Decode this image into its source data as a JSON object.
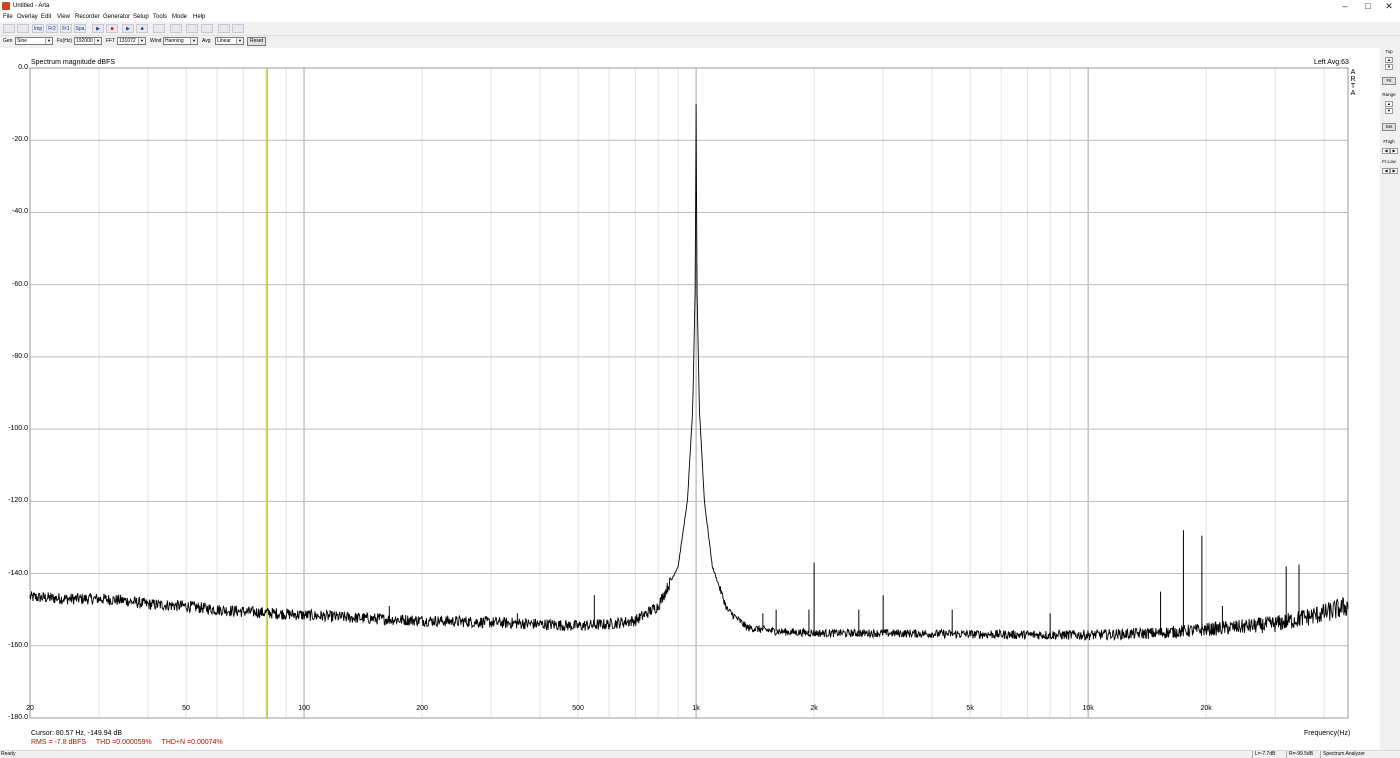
{
  "window": {
    "title": "Untitled - Arta",
    "minimize_glyph": "–",
    "maximize_glyph": "□",
    "close_glyph": "✕"
  },
  "menu": [
    "File",
    "Overlay",
    "Edit",
    "View",
    "Recorder",
    "Generator",
    "Setup",
    "Tools",
    "Mode",
    "Help"
  ],
  "toolbar_buttons": [
    {
      "icon": "open-icon",
      "glyph": ""
    },
    {
      "icon": "save-icon",
      "glyph": ""
    },
    {
      "icon": "impulse-response-icon",
      "glyph": "Imp"
    },
    {
      "icon": "frequency-response-2-icon",
      "glyph": "Fr2"
    },
    {
      "icon": "frequency-response-1-icon",
      "glyph": "Fr1"
    },
    {
      "icon": "spectrum-analyzer-icon",
      "glyph": "Spa"
    },
    {
      "icon": "play-icon",
      "glyph": "▶"
    },
    {
      "icon": "record-icon",
      "glyph": "■"
    },
    {
      "icon": "play-icon",
      "glyph": "▶"
    },
    {
      "icon": "stop-icon",
      "glyph": "■"
    },
    {
      "icon": "graph-icon",
      "glyph": ""
    },
    {
      "icon": "graph-options-icon",
      "glyph": ""
    },
    {
      "icon": "link-icon",
      "glyph": ""
    },
    {
      "icon": "toggle-icon",
      "glyph": ""
    },
    {
      "icon": "scope-icon",
      "glyph": ""
    },
    {
      "icon": "view-icon",
      "glyph": ""
    }
  ],
  "controls": {
    "gen_label": "Gen",
    "gen_value": "Sine",
    "fs_label": "Fs(Hz)",
    "fs_value": "192000",
    "fft_label": "FFT",
    "fft_value": "131072",
    "wind_label": "Wind",
    "wind_value": "Hanning",
    "avg_label": "Avg",
    "avg_value": "Linear",
    "reset_label": "Reset",
    "dropdown_arrow": "▼"
  },
  "chart_header": {
    "title": "Spectrum magnitude dBFS",
    "status": "Left  Avg:63",
    "logo_letters": [
      "A",
      "R",
      "T",
      "A"
    ]
  },
  "readouts": {
    "cursor": "Cursor: 80.57 Hz, -149.94 dB",
    "rms": "RMS =  -7.8 dBFS",
    "thd": "THD =0.000059%",
    "thdn": "THD+N =0.00074%"
  },
  "side_panel": {
    "top_label": "Top",
    "fit_label": "Fit",
    "range_label": "Range",
    "set_label": "Set",
    "fhigh_label": "Fhigh",
    "flow_label": "Fr.Low",
    "up_glyph": "▲",
    "down_glyph": "▼",
    "left_glyph": "◀",
    "right_glyph": "▶"
  },
  "statusbar": {
    "ready": "Ready",
    "left_level": "L=-7.7dB",
    "right_level": "R=-99.5dB",
    "mode": "Spectrum Analyzer"
  },
  "colors": {
    "trace": "#000000",
    "grid": "#c8c8c8",
    "cursor_line": "#c6c830",
    "readout_red": "#d40000"
  },
  "chart_data": {
    "type": "line",
    "title": "Spectrum magnitude dBFS",
    "xlabel": "Frequency(Hz)",
    "ylabel": "",
    "x_scale": "log",
    "xlim": [
      20,
      46000
    ],
    "ylim": [
      -180,
      0
    ],
    "grid": true,
    "y_ticks": [
      "0.0",
      "-20.0",
      "-40.0",
      "-60.0",
      "-80.0",
      "-100.0",
      "-120.0",
      "-140.0",
      "-160.0",
      "-180.0"
    ],
    "y_tick_values": [
      0,
      -20,
      -40,
      -60,
      -80,
      -100,
      -120,
      -140,
      -160,
      -180
    ],
    "x_ticks": [
      {
        "label": "20",
        "value": 20
      },
      {
        "label": "50",
        "value": 50
      },
      {
        "label": "100",
        "value": 100
      },
      {
        "label": "200",
        "value": 200
      },
      {
        "label": "500",
        "value": 500
      },
      {
        "label": "1k",
        "value": 1000
      },
      {
        "label": "2k",
        "value": 2000
      },
      {
        "label": "5k",
        "value": 5000
      },
      {
        "label": "10k",
        "value": 10000
      },
      {
        "label": "20k",
        "value": 20000
      }
    ],
    "cursor_hz": 80.57,
    "noise_floor": [
      [
        20,
        -146.5
      ],
      [
        25,
        -147
      ],
      [
        30,
        -147
      ],
      [
        35,
        -147.5
      ],
      [
        40,
        -148.5
      ],
      [
        50,
        -149
      ],
      [
        60,
        -150
      ],
      [
        70,
        -150.5
      ],
      [
        100,
        -151.5
      ],
      [
        150,
        -152.5
      ],
      [
        200,
        -153
      ],
      [
        300,
        -153.5
      ],
      [
        400,
        -154
      ],
      [
        500,
        -154.5
      ],
      [
        600,
        -154
      ],
      [
        700,
        -153
      ],
      [
        800,
        -149
      ],
      [
        900,
        -138
      ],
      [
        950,
        -120
      ],
      [
        980,
        -95
      ],
      [
        995,
        -60
      ],
      [
        1000,
        -10
      ],
      [
        1005,
        -60
      ],
      [
        1020,
        -95
      ],
      [
        1050,
        -120
      ],
      [
        1100,
        -138
      ],
      [
        1200,
        -150
      ],
      [
        1350,
        -155
      ],
      [
        1600,
        -156
      ],
      [
        2000,
        -156.5
      ],
      [
        3000,
        -156.5
      ],
      [
        5000,
        -156.8
      ],
      [
        8000,
        -157
      ],
      [
        10000,
        -157
      ],
      [
        15000,
        -156.5
      ],
      [
        20000,
        -155.5
      ],
      [
        30000,
        -154
      ],
      [
        40000,
        -151
      ],
      [
        46000,
        -149
      ]
    ],
    "spurs": [
      {
        "x": 165,
        "y": -149
      },
      {
        "x": 350,
        "y": -151
      },
      {
        "x": 550,
        "y": -146
      },
      {
        "x": 1480,
        "y": -151
      },
      {
        "x": 1600,
        "y": -150
      },
      {
        "x": 1940,
        "y": -150
      },
      {
        "x": 2000,
        "y": -137
      },
      {
        "x": 2600,
        "y": -150
      },
      {
        "x": 3000,
        "y": -146
      },
      {
        "x": 4500,
        "y": -150
      },
      {
        "x": 8000,
        "y": -151
      },
      {
        "x": 15300,
        "y": -145
      },
      {
        "x": 17500,
        "y": -128
      },
      {
        "x": 19500,
        "y": -129.5
      },
      {
        "x": 22000,
        "y": -149
      },
      {
        "x": 32000,
        "y": -138
      },
      {
        "x": 34500,
        "y": -137.5
      }
    ]
  }
}
